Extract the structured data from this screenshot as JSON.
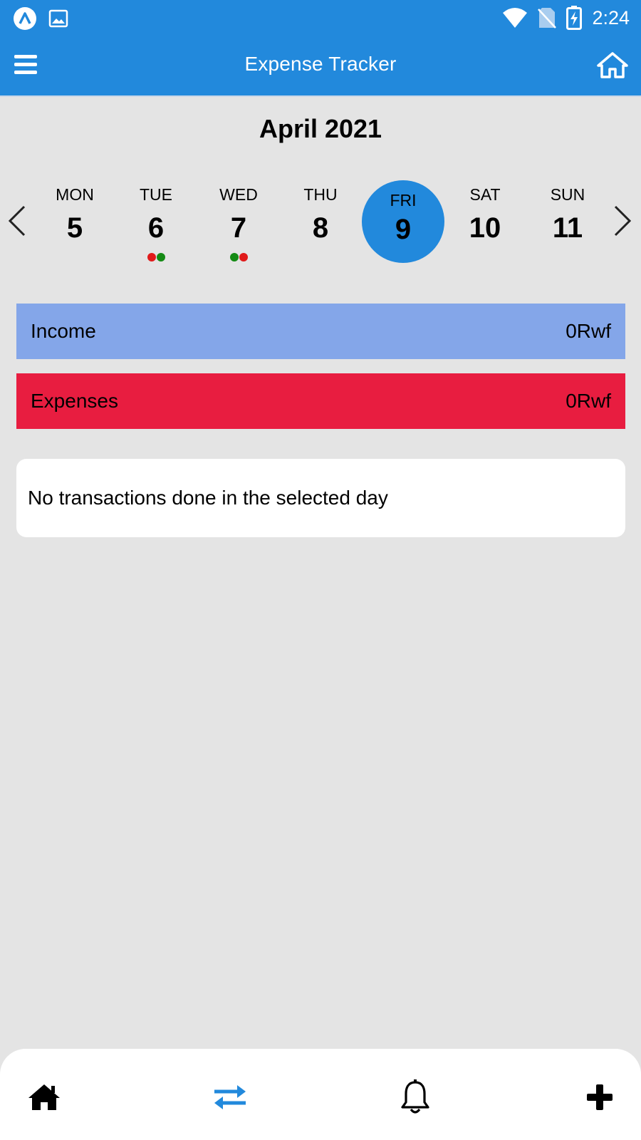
{
  "status_bar": {
    "time": "2:24",
    "left_icons": [
      "app-logo-icon",
      "image-icon"
    ],
    "right_icons": [
      "wifi-icon",
      "no-sim-icon",
      "battery-charging-icon"
    ]
  },
  "app_bar": {
    "title": "Expense Tracker",
    "menu_icon": "hamburger-menu-icon",
    "home_icon": "home-icon"
  },
  "calendar": {
    "month_label": "April 2021",
    "days": [
      {
        "name": "MON",
        "num": "5",
        "selected": false,
        "dots": []
      },
      {
        "name": "TUE",
        "num": "6",
        "selected": false,
        "dots": [
          "#e01a1a",
          "#148a14"
        ]
      },
      {
        "name": "WED",
        "num": "7",
        "selected": false,
        "dots": [
          "#148a14",
          "#e01a1a"
        ]
      },
      {
        "name": "THU",
        "num": "8",
        "selected": false,
        "dots": []
      },
      {
        "name": "FRI",
        "num": "9",
        "selected": true,
        "dots": []
      },
      {
        "name": "SAT",
        "num": "10",
        "selected": false,
        "dots": []
      },
      {
        "name": "SUN",
        "num": "11",
        "selected": false,
        "dots": []
      }
    ]
  },
  "summary": {
    "income_label": "Income",
    "income_value": "0Rwf",
    "expenses_label": "Expenses",
    "expenses_value": "0Rwf"
  },
  "transactions": {
    "empty_message": "No transactions done in the selected day"
  },
  "bottom_nav": {
    "items": [
      {
        "icon": "home-icon",
        "active": false
      },
      {
        "icon": "transfer-arrows-icon",
        "active": true
      },
      {
        "icon": "bell-icon",
        "active": false
      },
      {
        "icon": "plus-icon",
        "active": false
      }
    ]
  },
  "colors": {
    "primary": "#2289dc",
    "income_bg": "#84a6e9",
    "expenses_bg": "#e81d40",
    "background": "#e4e4e4",
    "income_dot": "#148a14",
    "expense_dot": "#e01a1a"
  }
}
